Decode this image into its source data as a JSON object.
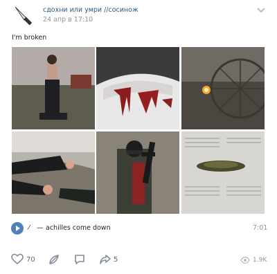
{
  "post": {
    "group_name": "сдохни или умри //сосинож",
    "date": "24 апр в 17:10",
    "text": "I'm broken"
  },
  "icons": {
    "avatar": "knife-icon",
    "menu": "chevron-down-icon",
    "play": "play-icon",
    "like": "heart-icon",
    "second": "feather-icon",
    "comment": "comment-icon",
    "share": "share-icon",
    "views": "eye-icon"
  },
  "photos": [
    {
      "description": "shirtless person outdoors at dusk"
    },
    {
      "description": "white car with red stains"
    },
    {
      "description": "dim ferris wheel with fire"
    },
    {
      "description": "two hands reaching over a landscape"
    },
    {
      "description": "masked person holding a gun"
    },
    {
      "description": "newspaper with dried herbs"
    }
  ],
  "audio": {
    "artist": "⁄",
    "separator": "—",
    "title": "achilles come down",
    "duration": "7:01"
  },
  "actions": {
    "likes": "70",
    "shares": "5",
    "views": "1.9K"
  },
  "colors": {
    "link": "#2a5885",
    "accent": "#5181b8",
    "secondary_text": "#909499"
  }
}
